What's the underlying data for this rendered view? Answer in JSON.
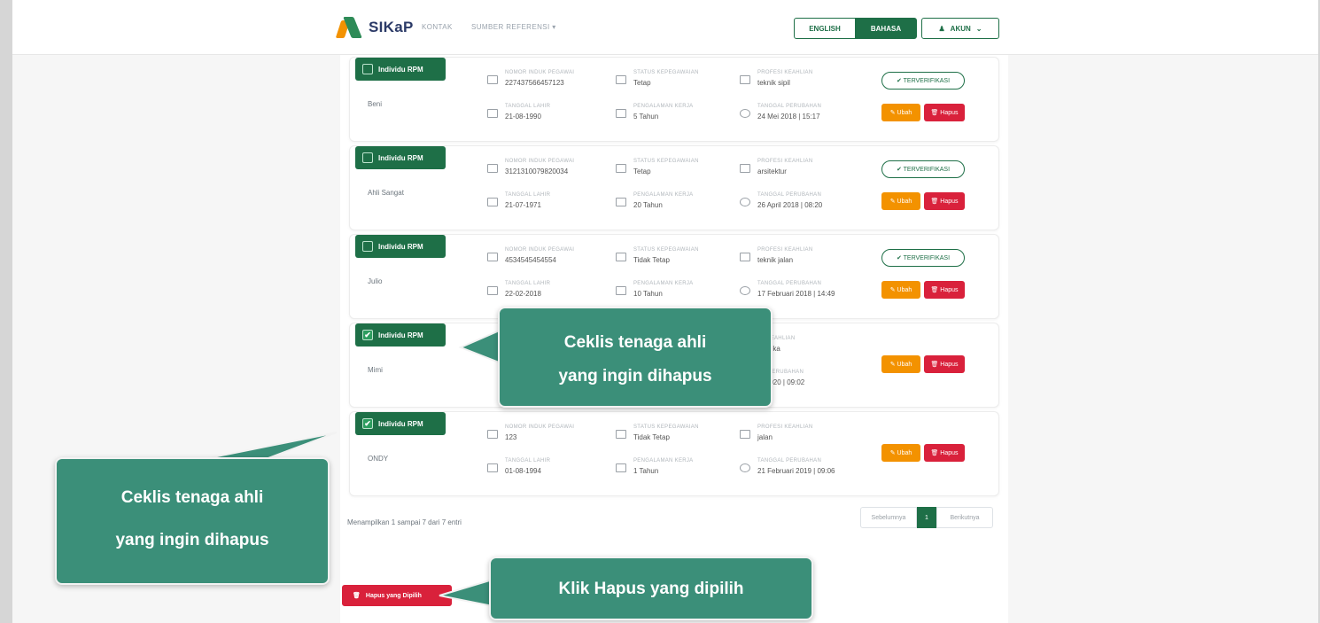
{
  "header": {
    "logo_text": "SIKaP",
    "nav": [
      "KONTAK",
      "SUMBER REFERENSI ▾"
    ],
    "lang_en": "ENGLISH",
    "lang_id": "BAHASA",
    "account": "AKUN"
  },
  "cards": [
    {
      "tag": "Individu RPM",
      "name": "Beni",
      "f1_label": "NOMOR INDUK PEGAWAI",
      "f1_value": "227437566457123",
      "f2_label": "STATUS KEPEGAWAIAN",
      "f2_value": "Tetap",
      "f3_label": "PROFESI KEAHLIAN",
      "f3_value": "teknik sipil",
      "f4_label": "TANGGAL LAHIR",
      "f4_value": "21-08-1990",
      "f5_label": "PENGALAMAN KERJA",
      "f5_value": "5 Tahun",
      "f6_label": "TANGGAL PERUBAHAN",
      "f6_value": "24 Mei 2018 | 15:17",
      "verified": "✔ TERVERIFIKASI",
      "checked": false
    },
    {
      "tag": "Individu RPM",
      "name": "Ahli Sangat",
      "f1_label": "NOMOR INDUK PEGAWAI",
      "f1_value": "3121310079820034",
      "f2_label": "STATUS KEPEGAWAIAN",
      "f2_value": "Tetap",
      "f3_label": "PROFESI KEAHLIAN",
      "f3_value": "arsitektur",
      "f4_label": "TANGGAL LAHIR",
      "f4_value": "21-07-1971",
      "f5_label": "PENGALAMAN KERJA",
      "f5_value": "20 Tahun",
      "f6_label": "TANGGAL PERUBAHAN",
      "f6_value": "26 April 2018 | 08:20",
      "verified": "✔ TERVERIFIKASI",
      "checked": false
    },
    {
      "tag": "Individu RPM",
      "name": "Julio",
      "f1_label": "NOMOR INDUK PEGAWAI",
      "f1_value": "4534545454554",
      "f2_label": "STATUS KEPEGAWAIAN",
      "f2_value": "Tidak Tetap",
      "f3_label": "PROFESI KEAHLIAN",
      "f3_value": "teknik jalan",
      "f4_label": "TANGGAL LAHIR",
      "f4_value": "22-02-2018",
      "f5_label": "PENGALAMAN KERJA",
      "f5_value": "10 Tahun",
      "f6_label": "TANGGAL PERUBAHAN",
      "f6_value": "17 Februari 2018 | 14:49",
      "verified": "✔ TERVERIFIKASI",
      "checked": false
    },
    {
      "tag": "Individu RPM",
      "name": "Mimi",
      "f1_label": "",
      "f1_value": "",
      "f2_label": "",
      "f2_value": "",
      "f3_label": "PROFESI KEAHLIAN",
      "f3_value": "k.Informatika",
      "f4_label": "",
      "f4_value": "",
      "f5_label": "",
      "f5_value": "",
      "f6_label": "TANGGAL PERUBAHAN",
      "f6_value": "vember 2020 | 09:02",
      "verified": "",
      "checked": true
    },
    {
      "tag": "Individu RPM",
      "name": "ONDY",
      "f1_label": "NOMOR INDUK PEGAWAI",
      "f1_value": "123",
      "f2_label": "STATUS KEPEGAWAIAN",
      "f2_value": "Tidak Tetap",
      "f3_label": "PROFESI KEAHLIAN",
      "f3_value": "jalan",
      "f4_label": "TANGGAL LAHIR",
      "f4_value": "01-08-1994",
      "f5_label": "PENGALAMAN KERJA",
      "f5_value": "1 Tahun",
      "f6_label": "TANGGAL PERUBAHAN",
      "f6_value": "21 Februari 2019 | 09:06",
      "verified": "",
      "checked": true
    }
  ],
  "actions": {
    "ubah": "Ubah",
    "hapus": "Hapus"
  },
  "footer": {
    "showing": "Menampilkan 1 sampai 7 dari 7 entri",
    "prev": "Sebelumnya",
    "page": "1",
    "next": "Berikutnya",
    "delete_selected": "Hapus yang Dipilih"
  },
  "callouts": {
    "c1_line1": "Ceklis tenaga ahli",
    "c1_line2": "yang ingin dihapus",
    "c2_line1": "Ceklis tenaga ahli",
    "c2_line2": "yang ingin dihapus",
    "c3": "Klik Hapus yang dipilih"
  },
  "colors": {
    "primary": "#1e6f47",
    "danger": "#d9213b",
    "warning": "#f39200",
    "callout": "#3b8f79"
  }
}
